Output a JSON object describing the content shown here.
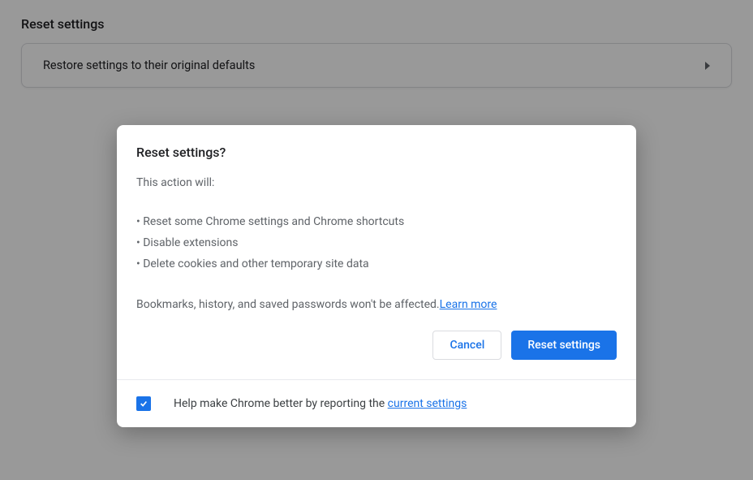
{
  "background": {
    "section_title": "Reset settings",
    "row_label": "Restore settings to their original defaults"
  },
  "dialog": {
    "title": "Reset settings?",
    "intro": "This action will:",
    "bullets": [
      "• Reset some Chrome settings and Chrome shortcuts",
      "• Disable extensions",
      "• Delete cookies and other temporary site data"
    ],
    "footnote_text": "Bookmarks, history, and saved passwords won't be affected.",
    "learn_more": "Learn more",
    "cancel_label": "Cancel",
    "confirm_label": "Reset settings",
    "footer_text": "Help make Chrome better by reporting the ",
    "footer_link": "current settings"
  }
}
